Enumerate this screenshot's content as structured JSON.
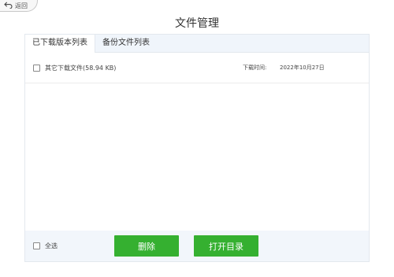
{
  "nav": {
    "back_label": "返回"
  },
  "page": {
    "title": "文件管理"
  },
  "tabs": [
    {
      "label": "已下载版本列表",
      "active": true
    },
    {
      "label": "备份文件列表",
      "active": false
    }
  ],
  "files": [
    {
      "name": "其它下载文件(58.94 KB)",
      "checked": false,
      "download_time_label": "下载时间:",
      "download_time": "2022年10月27日"
    }
  ],
  "footer": {
    "select_all_label": "全选",
    "delete_label": "删除",
    "open_dir_label": "打开目录"
  },
  "colors": {
    "accent_green": "#35b030",
    "tab_bar_bg": "#f0f5fb",
    "footer_bg": "#f2f6fb"
  }
}
